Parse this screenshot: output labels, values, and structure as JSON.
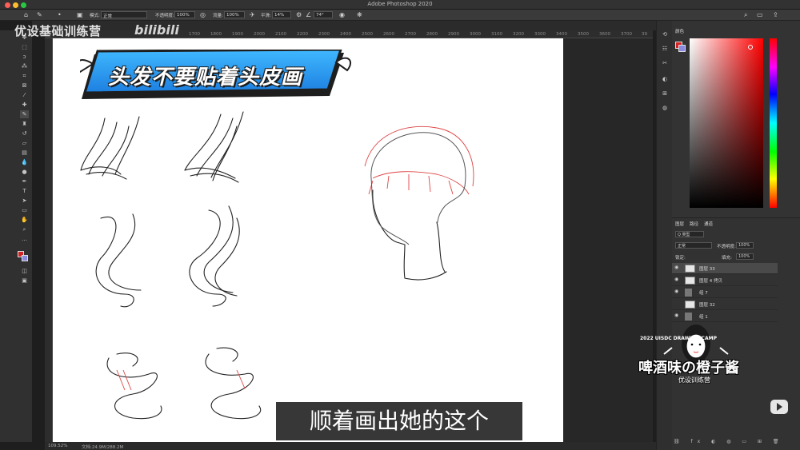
{
  "app": {
    "title": "Adobe Photoshop 2020"
  },
  "options": {
    "mode_label": "模式:",
    "mode_value": "正常",
    "opacity_label": "不透明度:",
    "opacity_value": "100%",
    "flow_label": "流量:",
    "flow_value": "100%",
    "smooth_label": "平滑:",
    "smooth_value": "14%",
    "angle_value": "74°"
  },
  "ruler": {
    "ticks": [
      "1700",
      "1800",
      "1900",
      "2000",
      "2100",
      "2200",
      "2300",
      "2400",
      "2500",
      "2600",
      "2700",
      "2800",
      "2900",
      "3000",
      "3100",
      "3200",
      "3300",
      "3400",
      "3500",
      "3600",
      "3700",
      "3800",
      "39"
    ]
  },
  "status": {
    "zoom": "109.52%",
    "doc": "文档:24.9M/288.2M"
  },
  "panels": {
    "color_tab": "颜色",
    "layers_tabs": [
      "图层",
      "路径",
      "通道"
    ],
    "kind_filter": "Q 类型",
    "blend_mode": "正常",
    "opacity_label": "不透明度:",
    "opacity_value": "100%",
    "lock_label": "锁定:",
    "fill_label": "填充:",
    "fill_value": "100%"
  },
  "layers": [
    {
      "name": "图层 33",
      "selected": true
    },
    {
      "name": "图层 4 拷贝",
      "selected": false
    },
    {
      "name": "组 7",
      "selected": false
    },
    {
      "name": "图层 32",
      "selected": false
    },
    {
      "name": "组 1",
      "selected": false
    }
  ],
  "overlay": {
    "watermark": "优设基础训练营",
    "bilibili": "bilibili",
    "banner": "头发不要贴着头皮画",
    "subtitle": "顺着画出她的这个",
    "stamp_main": "啤酒味の橙子酱",
    "stamp_sub": "优设训练营",
    "stamp_ring": "2022 UISDC DRAWING CAMP"
  },
  "colors": {
    "foreground": "#d42325",
    "background": "#8a8ae0",
    "accent": "#1e88e5"
  }
}
